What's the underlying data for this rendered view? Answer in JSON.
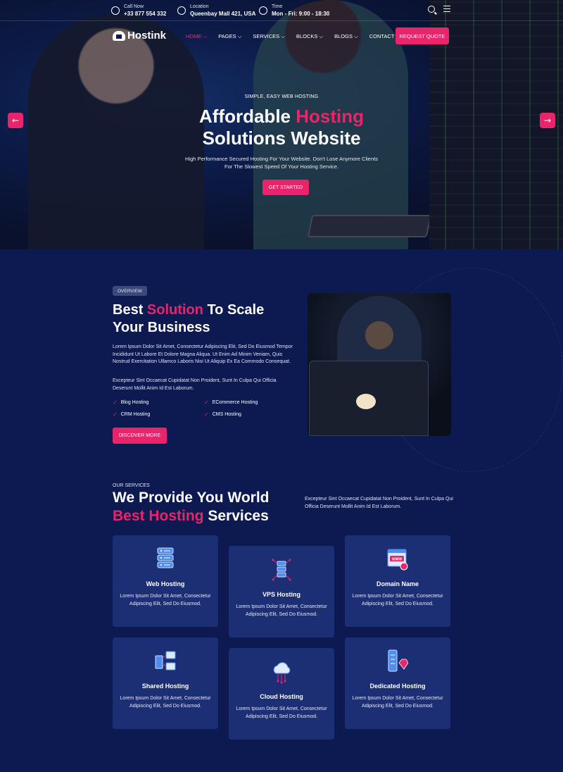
{
  "topbar": {
    "call": {
      "label": "Call Now",
      "value": "+33 877 554 332"
    },
    "location": {
      "label": "Location",
      "value": "Queenbay Mall 421, USA"
    },
    "time": {
      "label": "Time",
      "value": "Mon - Fri: 9:00 - 18:30"
    }
  },
  "nav": {
    "logo": "Hostink",
    "items": [
      "HOME ⌵",
      "PAGES ⌵",
      "SERVICES ⌵",
      "BLOCKS ⌵",
      "BLOGS ⌵",
      "CONTACT"
    ],
    "quote": "REQUEST QUOTE"
  },
  "hero": {
    "kicker": "SIMPLE, EASY WEB HOSTING",
    "title_a": "Affordable ",
    "title_b": "Hosting",
    "title_c": "Solutions Website",
    "desc_1": "High Performance Secured Hosting For Your Website. Don't Lose Anymore Clients",
    "desc_2": "For The Slowest Speed Of Your Hosting Service.",
    "cta": "GET STARTED",
    "prev": "←",
    "next": "→"
  },
  "overview": {
    "pill": "OVERVIEW",
    "title_a": "Best ",
    "title_b": "Solution",
    "title_c": " To Scale",
    "title_d": "Your Business",
    "p1": "Lorem Ipsum Dolor Sit Amet, Consectetur Adipiscing Elit, Sed Do Eiusmod Tempor Incididunt Ut Labore Et Dolore Magna Aliqua. Ut Enim Ad Minim Veniam, Quis Nostrud Exercitation Ullamco Laboris Nisi Ut Aliquip Ex Ea Commodo Consequat.",
    "p2": "Excepteur Sint Occaecat Cupidatat Non Proident, Sunt In Culpa Qui Officia Deserunt Mollit Anim Id Est Laborum.",
    "checks": [
      "Blog Hosting",
      "ECommerce Hosting",
      "CRM Hosting",
      "CMS Hosting"
    ],
    "check_mark": "✓",
    "cta": "DISCOVER MORE"
  },
  "services": {
    "eyebrow": "OUR SERVICES",
    "title_a": "We Provide You World",
    "title_b": "Best Hosting",
    "title_c": " Services",
    "desc": "Excepteur Sint Occaecat Cupidatat Non Proident, Sunt In Culpa Qui Officia Deserunt Mollit Anim Id Est Laborum.",
    "cards": [
      {
        "title": "Web Hosting",
        "desc": "Lorem Ipsum Dolor Sit Amet, Consectetur Adipiscing Elit, Sed Do Eiusmod.",
        "icon": "server-stack-icon"
      },
      {
        "title": "VPS Hosting",
        "desc": "Lorem Ipsum Dolor Sit Amet, Consectetur Adipiscing Elit, Sed Do Eiusmod.",
        "icon": "vps-network-icon"
      },
      {
        "title": "Domain Name",
        "desc": "Lorem Ipsum Dolor Sit Amet, Consectetur Adipiscing Elit, Sed Do Eiusmod.",
        "icon": "www-browser-icon",
        "icon_text": "WWW"
      },
      {
        "title": "Shared Hosting",
        "desc": "Lorem Ipsum Dolor Sit Amet, Consectetur Adipiscing Elit, Sed Do Eiusmod.",
        "icon": "shared-monitors-icon"
      },
      {
        "title": "Cloud Hosting",
        "desc": "Lorem Ipsum Dolor Sit Amet, Consectetur Adipiscing Elit, Sed Do Eiusmod.",
        "icon": "cloud-icon"
      },
      {
        "title": "Dedicated Hosting",
        "desc": "Lorem Ipsum Dolor Sit Amet, Consectetur Adipiscing Elit, Sed Do Eiusmod.",
        "icon": "dedicated-server-icon"
      }
    ]
  },
  "colors": {
    "accent": "#e8256a",
    "background": "#0d1a52",
    "card": "#1d2f74"
  }
}
